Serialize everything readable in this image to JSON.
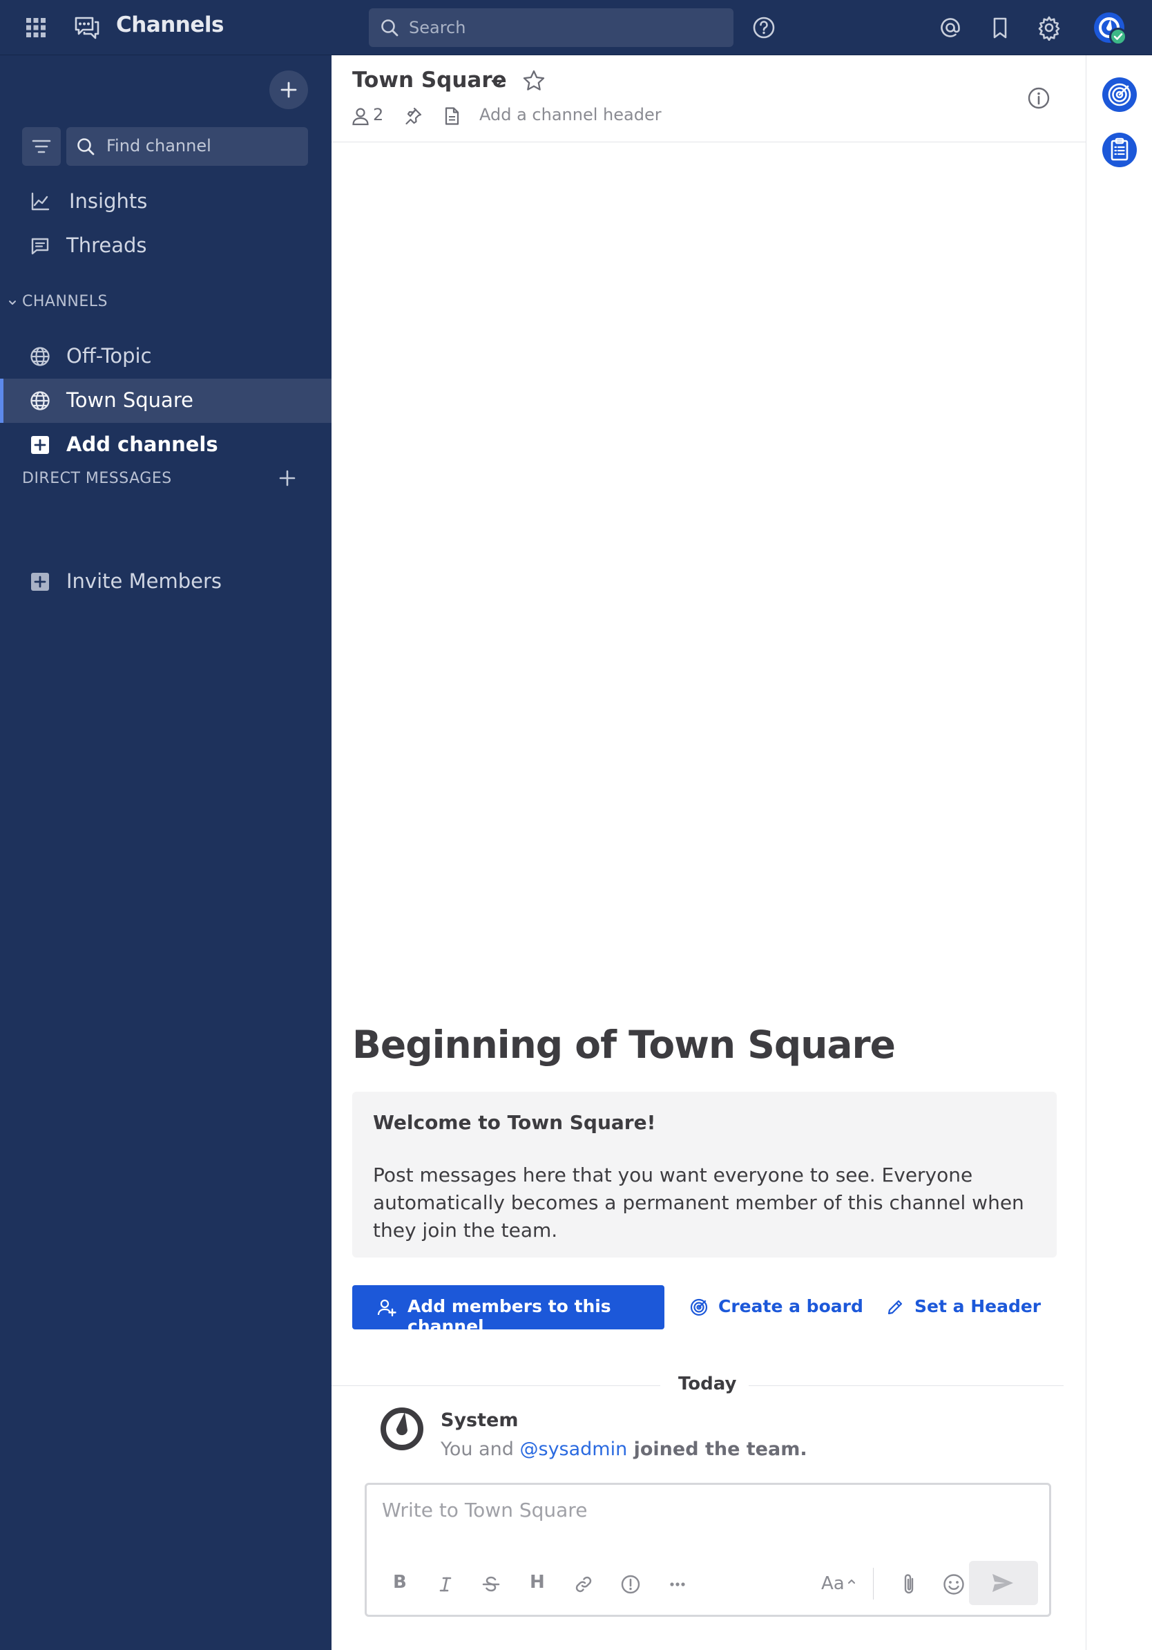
{
  "topbar": {
    "product_name": "Channels",
    "search_placeholder": "Search"
  },
  "sidebar": {
    "find_channel": "Find channel",
    "nav": [
      {
        "label": "Insights"
      },
      {
        "label": "Threads"
      }
    ],
    "channels_header": "CHANNELS",
    "channels": [
      {
        "label": "Off-Topic",
        "active": false
      },
      {
        "label": "Town Square",
        "active": true
      }
    ],
    "add_channels": "Add channels",
    "dm_header": "DIRECT MESSAGES",
    "invite_members": "Invite Members"
  },
  "channel_header": {
    "title": "Town Square",
    "member_count": "2",
    "add_header": "Add a channel header"
  },
  "intro": {
    "title": "Beginning of Town Square",
    "welcome": "Welcome to Town Square!",
    "description": "Post messages here that you want everyone to see. Everyone automatically becomes a permanent member of this channel when they join the team.",
    "add_members": "Add members to this channel",
    "create_board": "Create a board",
    "set_header": "Set a Header"
  },
  "date_separator": "Today",
  "post": {
    "author": "System",
    "msg_prefix": "You and ",
    "mention": "@sysadmin",
    "msg_suffix": " joined the team."
  },
  "composer": {
    "placeholder": "Write to Town Square",
    "formatting": [
      "bold",
      "italic",
      "strikethrough",
      "heading",
      "link",
      "info",
      "more"
    ],
    "aa_label": "Aa"
  },
  "colors": {
    "sidebar_bg": "#1e325c",
    "accent": "#1c58d9",
    "active_indicator": "#5d89ea",
    "online": "#3db887"
  }
}
